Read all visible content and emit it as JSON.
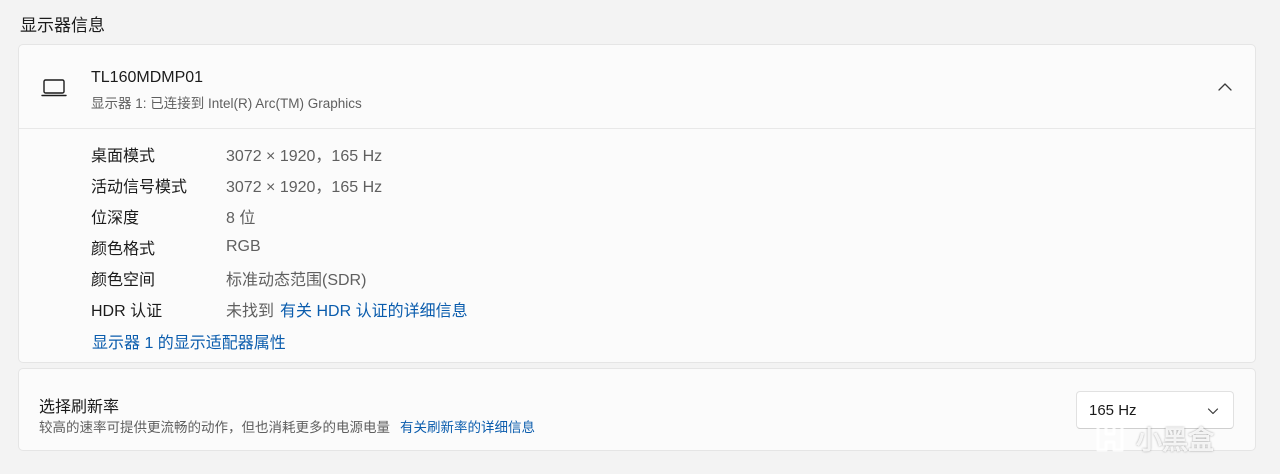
{
  "section_title": "显示器信息",
  "monitor": {
    "name": "TL160MDMP01",
    "subtitle": "显示器 1: 已连接到 Intel(R) Arc(TM) Graphics",
    "icon": "laptop-icon",
    "collapse_icon": "chevron-up-icon"
  },
  "info_rows": [
    {
      "label": "桌面模式",
      "value": "3072 × 1920，165 Hz"
    },
    {
      "label": "活动信号模式",
      "value": "3072 × 1920，165 Hz"
    },
    {
      "label": "位深度",
      "value": "8 位"
    },
    {
      "label": "颜色格式",
      "value": "RGB"
    },
    {
      "label": "颜色空间",
      "value": "标准动态范围(SDR)"
    },
    {
      "label": "HDR 认证",
      "value": "未找到",
      "link": "有关 HDR 认证的详细信息"
    }
  ],
  "adapter_link": "显示器 1 的显示适配器属性",
  "refresh": {
    "title": "选择刷新率",
    "description": "较高的速率可提供更流畅的动作，但也消耗更多的电源电量",
    "link": "有关刷新率的详细信息",
    "selected": "165 Hz",
    "dropdown_icon": "chevron-down-icon"
  },
  "watermark": {
    "text": "小黑盒",
    "icon": "heybox-logo-icon"
  },
  "colors": {
    "accent": "#0a5cad",
    "background": "#f3f3f3",
    "card": "#fbfbfb"
  }
}
